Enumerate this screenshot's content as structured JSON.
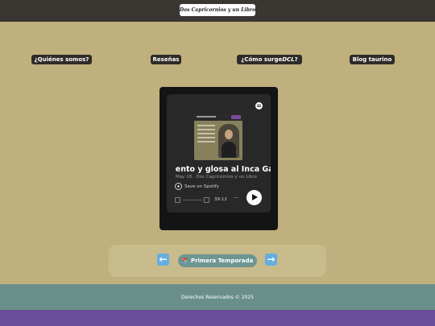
{
  "header": {
    "site_title": "Dos Capricornios y un Libro"
  },
  "nav": {
    "quienes": "¿Quiénes somos?",
    "resenas": "Reseñas",
    "como_prefix": "¿Cómo surge ",
    "como_italic": "DCL",
    "como_suffix": "?",
    "blog": "Blog taurino"
  },
  "player": {
    "episode_title": "nento y glosa al Inca Gar",
    "meta": "May 18 · Dos Capricornios y un Libro",
    "save_label": "Save on Spotify",
    "time": "39:12",
    "more": "···"
  },
  "pager": {
    "prev": "←",
    "season_label": "📚 Primera Temporada",
    "next": "→"
  },
  "footer": {
    "text": "Derechos Reservados © 2025"
  }
}
